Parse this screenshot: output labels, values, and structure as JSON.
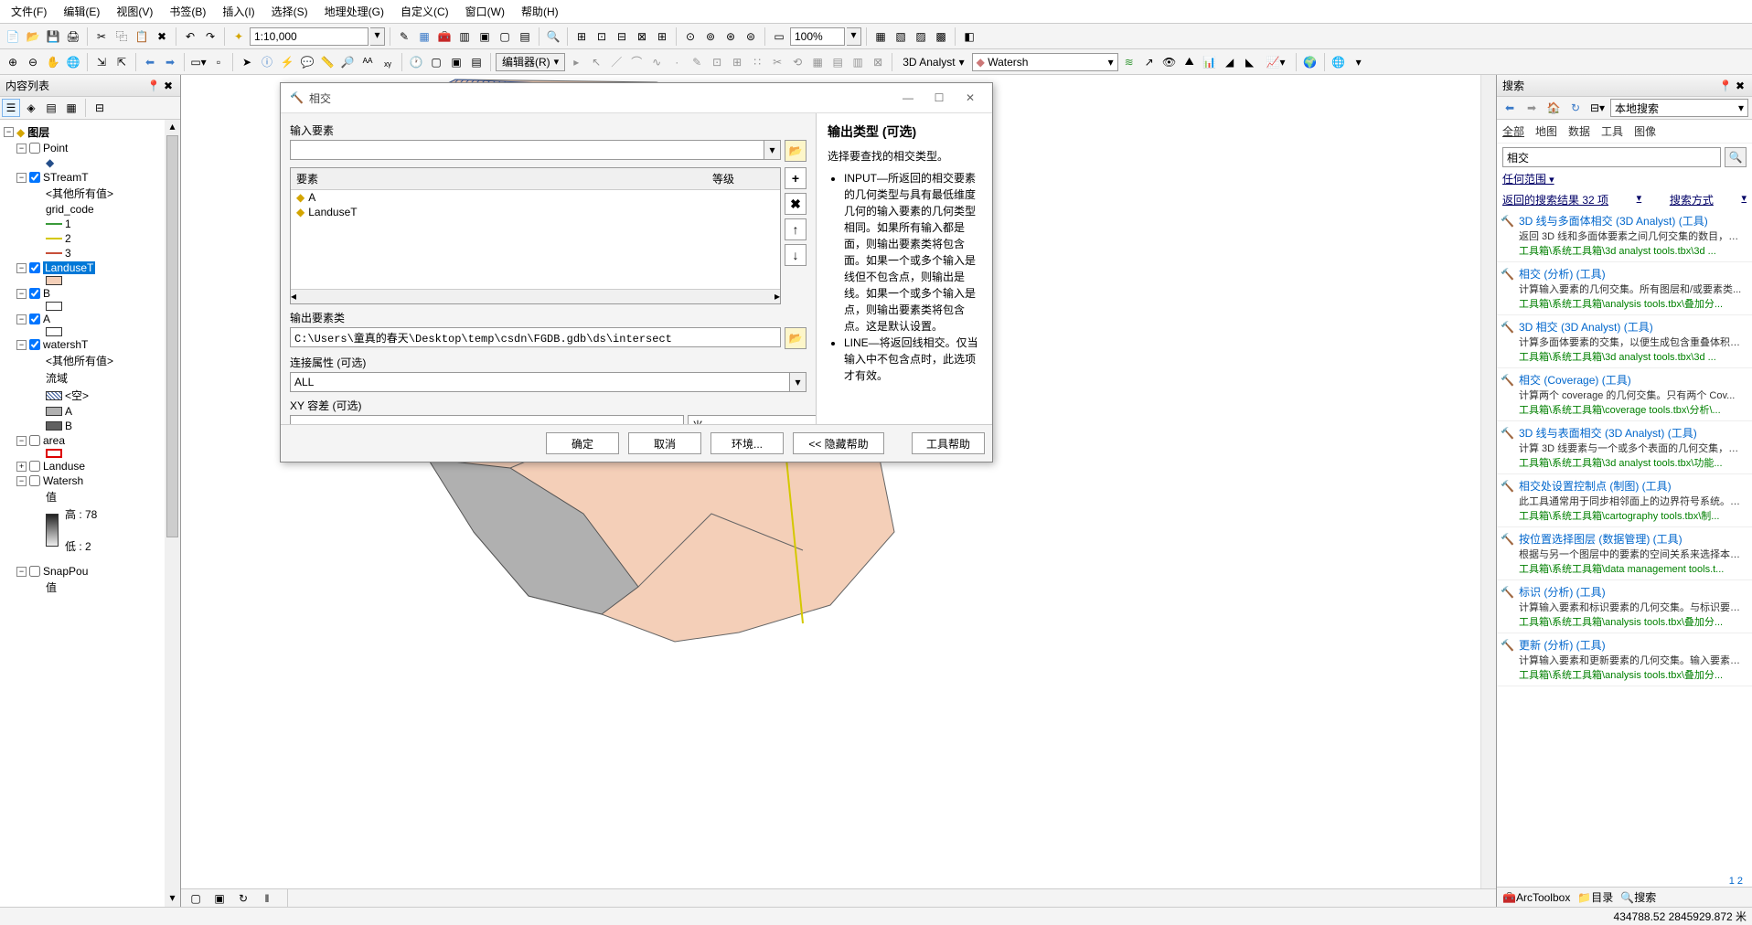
{
  "menu": [
    "文件(F)",
    "编辑(E)",
    "视图(V)",
    "书签(B)",
    "插入(I)",
    "选择(S)",
    "地理处理(G)",
    "自定义(C)",
    "窗口(W)",
    "帮助(H)"
  ],
  "scale": "1:10,000",
  "zoom_pct": "100%",
  "editor_label": "编辑器(R)",
  "analyst_label": "3D Analyst",
  "layer_combo": "Watersh",
  "toc": {
    "title": "内容列表",
    "root": "图层",
    "nodes": {
      "point": "Point",
      "streamt": "STreamT",
      "streamt_other": "<其他所有值>",
      "streamt_code": "grid_code",
      "v1": "1",
      "v2": "2",
      "v3": "3",
      "landuset": "LanduseT",
      "b": "B",
      "a": "A",
      "watersht": "watershT",
      "watersht_other": "<其他所有值>",
      "watersht_field": "流域",
      "watersht_empty": "<空>",
      "wa": "A",
      "wb": "B",
      "area": "area",
      "landuse": "Landuse",
      "watersh": "Watersh",
      "val": "值",
      "high": "高 : 78",
      "low": "低 : 2",
      "snappou": "SnapPou",
      "snappou_val": "值"
    }
  },
  "search": {
    "title": "搜索",
    "scope_label": "本地搜索",
    "tabs": [
      "全部",
      "地图",
      "数据",
      "工具",
      "图像"
    ],
    "query": "相交",
    "scope_link": "任何范围",
    "summary_l": "返回的搜索结果 32 项",
    "summary_r": "搜索方式",
    "results": [
      {
        "title": "3D 线与多面体相交 (3D Analyst) (工具)",
        "desc": "返回 3D 线和多面体要素之间几何交集的数目，并...",
        "path": "工具箱\\系统工具箱\\3d analyst tools.tbx\\3d ..."
      },
      {
        "title": "相交 (分析) (工具)",
        "desc": "计算输入要素的几何交集。所有图层和/或要素类...",
        "path": "工具箱\\系统工具箱\\analysis tools.tbx\\叠加分..."
      },
      {
        "title": "3D 相交 (3D Analyst) (工具)",
        "desc": "计算多面体要素的交集，以便生成包含重叠体积的...",
        "path": "工具箱\\系统工具箱\\3d analyst tools.tbx\\3d ..."
      },
      {
        "title": "相交 (Coverage) (工具)",
        "desc": "计算两个 coverage 的几何交集。只有两个 Cov...",
        "path": "工具箱\\系统工具箱\\coverage tools.tbx\\分析\\..."
      },
      {
        "title": "3D 线与表面相交 (3D Analyst) (工具)",
        "desc": "计算 3D 线要素与一个或多个表面的几何交集，并...",
        "path": "工具箱\\系统工具箱\\3d analyst tools.tbx\\功能..."
      },
      {
        "title": "相交处设置控制点 (制图) (工具)",
        "desc": "此工具通常用于同步相邻面上的边界符号系统。此...",
        "path": "工具箱\\系统工具箱\\cartography tools.tbx\\制..."
      },
      {
        "title": "按位置选择图层 (数据管理) (工具)",
        "desc": "根据与另一个图层中的要素的空间关系来选择本图...",
        "path": "工具箱\\系统工具箱\\data management tools.t..."
      },
      {
        "title": "标识 (分析) (工具)",
        "desc": "计算输入要素和标识要素的几何交集。与标识要素...",
        "path": "工具箱\\系统工具箱\\analysis tools.tbx\\叠加分..."
      },
      {
        "title": "更新 (分析) (工具)",
        "desc": "计算输入要素和更新要素的几何交集。输入要素的...",
        "path": "工具箱\\系统工具箱\\analysis tools.tbx\\叠加分..."
      }
    ],
    "pagination": "1 2",
    "bottom_tabs": [
      "ArcToolbox",
      "目录",
      "搜索"
    ]
  },
  "dialog": {
    "title": "相交",
    "labels": {
      "input_feat": "输入要素",
      "feat_col": "要素",
      "rank_col": "等级",
      "out_fc": "输出要素类",
      "join_attr": "连接属性 (可选)",
      "xy_tol": "XY 容差 (可选)"
    },
    "features": [
      "A",
      "LanduseT"
    ],
    "out_path": "C:\\Users\\童真的春天\\Desktop\\temp\\csdn\\FGDB.gdb\\ds\\intersect",
    "join_val": "ALL",
    "xy_unit": "米",
    "buttons": {
      "ok": "确定",
      "cancel": "取消",
      "env": "环境...",
      "hide": "<< 隐藏帮助",
      "toolhelp": "工具帮助"
    },
    "help": {
      "heading": "输出类型 (可选)",
      "intro": "选择要查找的相交类型。",
      "li1": "INPUT—所返回的相交要素的几何类型与具有最低维度几何的输入要素的几何类型相同。如果所有输入都是面，则输出要素类将包含面。如果一个或多个输入是线但不包含点，则输出是线。如果一个或多个输入是点，则输出要素类将包含点。这是默认设置。",
      "li2": "LINE—将返回线相交。仅当输入中不包含点时，此选项才有效。"
    }
  },
  "status_coords": "434788.52  2845929.872 米"
}
